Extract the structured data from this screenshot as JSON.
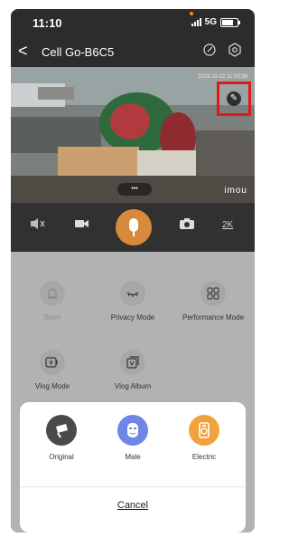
{
  "status": {
    "time": "11:10",
    "network": "5G"
  },
  "nav": {
    "back_glyph": "<",
    "title": "Cell Go-B6C5"
  },
  "video": {
    "timestamp": "2022-11-22 11:09:36",
    "brand": "imou",
    "pill": "•••"
  },
  "controls": {
    "resolution": "2K"
  },
  "features": [
    {
      "label": "Siren",
      "enabled": false,
      "icon": "siren-icon"
    },
    {
      "label": "Privacy Mode",
      "enabled": true,
      "icon": "eye-closed-icon"
    },
    {
      "label": "Performance Mode",
      "enabled": true,
      "icon": "grid-icon"
    },
    {
      "label": "Vlog Mode",
      "enabled": true,
      "icon": "vlog-icon"
    },
    {
      "label": "Vlog Album",
      "enabled": true,
      "icon": "album-icon"
    }
  ],
  "voice_sheet": {
    "options": [
      {
        "label": "Original",
        "color": "#4a4a4a",
        "icon": "original-voice-icon"
      },
      {
        "label": "Male",
        "color": "#6f86e6",
        "icon": "male-voice-icon"
      },
      {
        "label": "Electric",
        "color": "#f2a23c",
        "icon": "electric-voice-icon"
      }
    ],
    "cancel": "Cancel"
  }
}
